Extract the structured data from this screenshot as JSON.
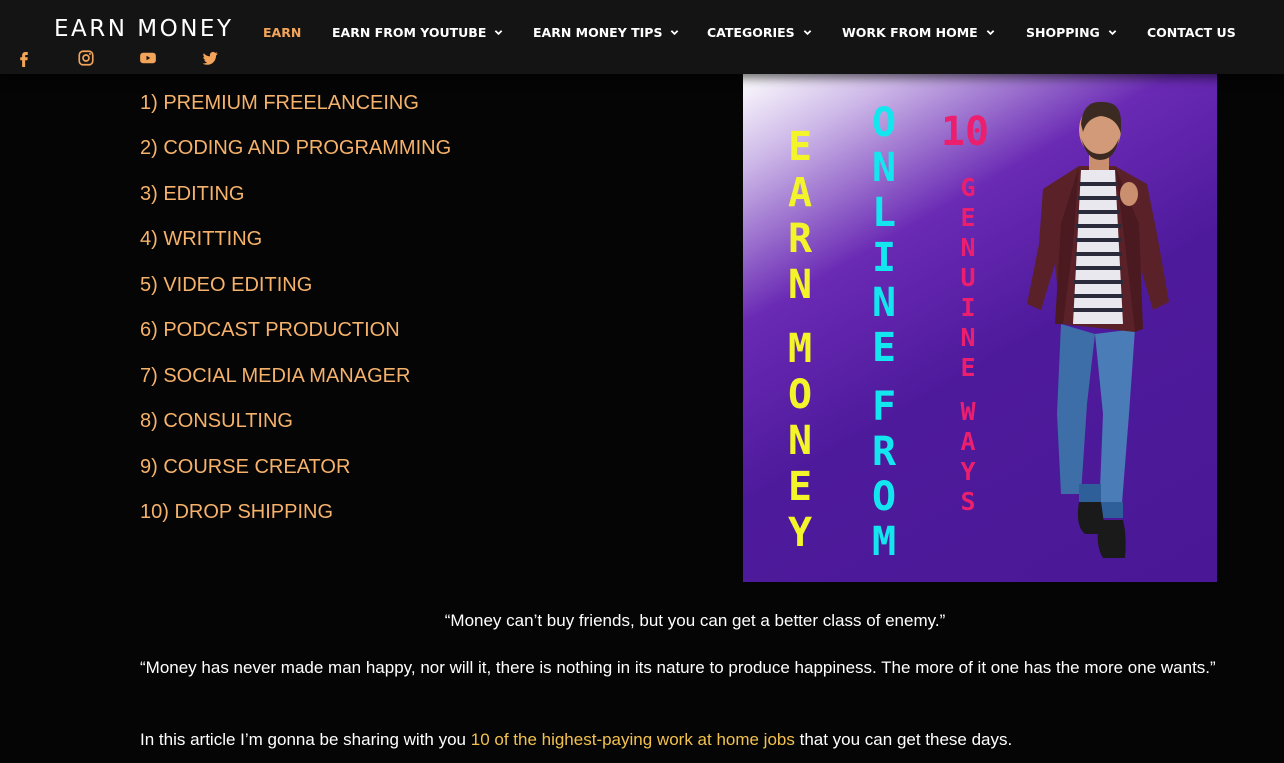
{
  "header": {
    "brand": "EARN MONEY",
    "socials": [
      {
        "icon": "facebook-icon"
      },
      {
        "icon": "instagram-icon"
      },
      {
        "icon": "youtube-icon"
      },
      {
        "icon": "twitter-icon"
      }
    ],
    "nav": [
      {
        "label": "EARN",
        "active": true
      },
      {
        "label": "EARN FROM YOUTUBE",
        "has_dropdown": true
      },
      {
        "label": "EARN MONEY TIPS",
        "has_dropdown": true
      },
      {
        "label": "CATEGORIES",
        "has_dropdown": true
      },
      {
        "label": "WORK FROM HOME",
        "has_dropdown": true
      },
      {
        "label": "SHOPPING",
        "has_dropdown": true
      },
      {
        "label": "CONTACT US"
      }
    ]
  },
  "list": [
    "1) PREMIUM FREELANCEING",
    "2) CODING AND PROGRAMMING",
    "3) EDITING",
    "4) WRITTING",
    "5) VIDEO EDITING",
    "6) PODCAST PRODUCTION",
    "7) SOCIAL MEDIA MANAGER",
    "8) CONSULTING",
    "9) COURSE CREATOR",
    "10) DROP SHIPPING"
  ],
  "hero": {
    "col1": "EARN MONEY",
    "col2": "ONLINE FROM",
    "num": "10",
    "col3": "GENUINE WAYS"
  },
  "quotes": {
    "q1": "“Money can’t buy friends, but you can get a better class of enemy.”",
    "q2": "“Money has never made man happy, nor will it, there is nothing in its nature to produce happiness. The more of it one has the more one wants.”"
  },
  "intro": {
    "before": "In this article I’m gonna be sharing with you ",
    "link": "10 of the highest-paying work at home jobs",
    "after": " that you can get these days."
  },
  "colors": {
    "accent": "#f2a55a",
    "list_text": "#f6b26b",
    "link": "#f2c14e",
    "hero_yellow": "#f4f42a",
    "hero_cyan": "#14e6f0",
    "hero_pink": "#ec1f6e",
    "hero_bg": "#4e1a9c"
  }
}
